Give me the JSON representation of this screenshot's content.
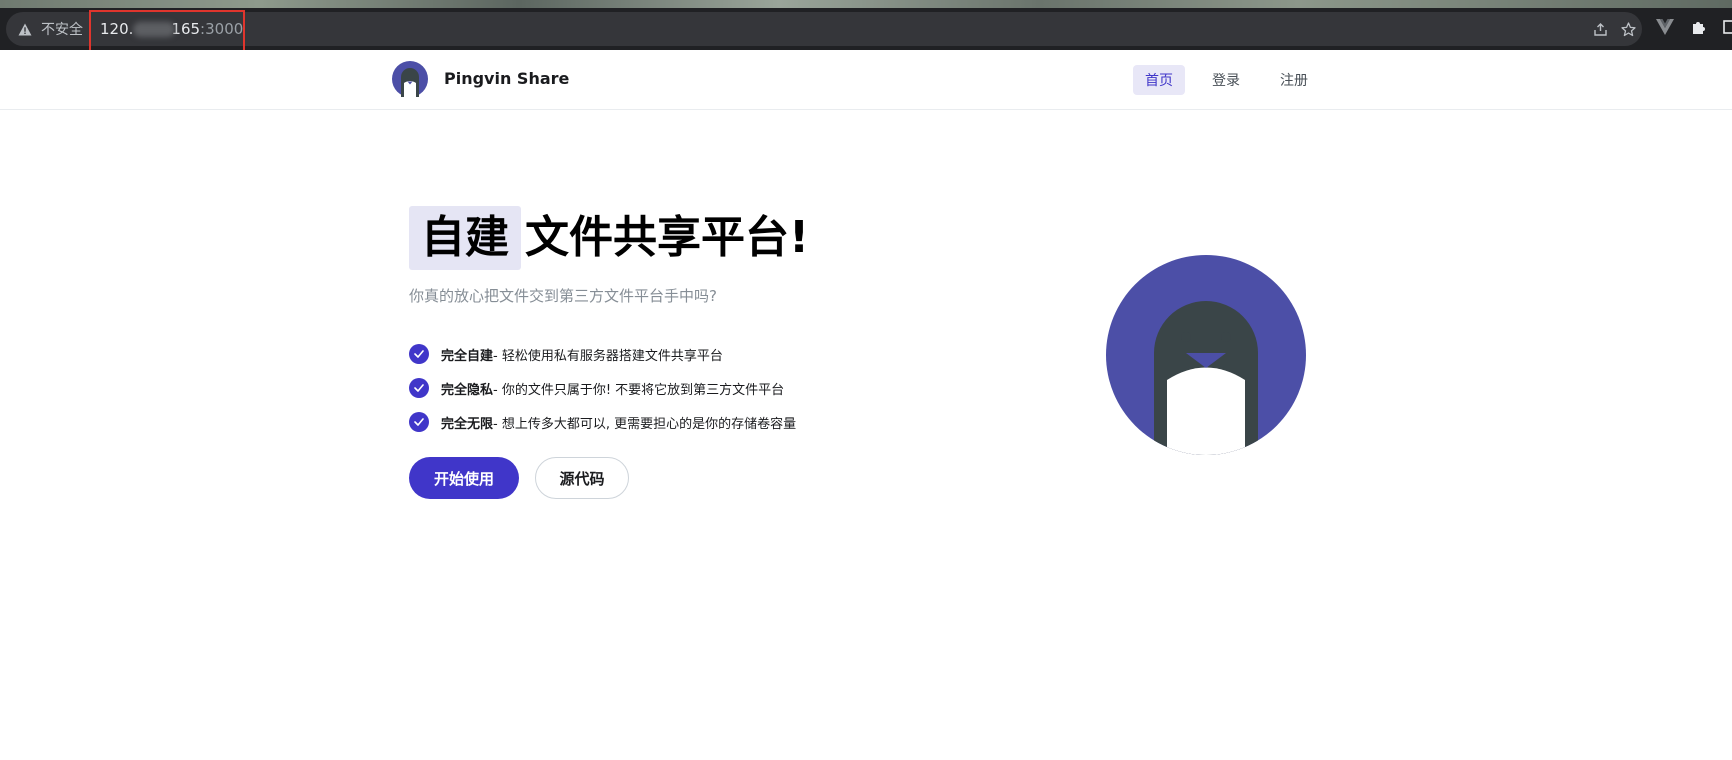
{
  "browser": {
    "security_label": "不安全",
    "url_host": "120.",
    "url_host_end": "165",
    "url_port": ":3000"
  },
  "header": {
    "brand": "Pingvin Share",
    "nav": [
      {
        "label": "首页",
        "active": true
      },
      {
        "label": "登录",
        "active": false
      },
      {
        "label": "注册",
        "active": false
      }
    ]
  },
  "hero": {
    "title_highlight": "自建",
    "title_rest": "文件共享平台!",
    "subtitle": "你真的放心把文件交到第三方文件平台手中吗?",
    "features": [
      {
        "title": "完全自建",
        "text": " - 轻松使用私有服务器搭建文件共享平台"
      },
      {
        "title": "完全隐私",
        "text": " - 你的文件只属于你! 不要将它放到第三方文件平台"
      },
      {
        "title": "完全无限",
        "text": " - 想上传多大都可以, 更需要担心的是你的存储卷容量"
      }
    ],
    "primary_button": "开始使用",
    "secondary_button": "源代码"
  },
  "colors": {
    "accent": "#4036c9",
    "highlight": "#e5e5f4",
    "logo_purple": "#4c4fa7",
    "penguin_body": "#3a4548"
  },
  "icons": {
    "warning": "warning-triangle-icon",
    "share": "share-icon",
    "bookmark": "star-icon",
    "extension": "puzzle-icon",
    "check": "check-icon"
  }
}
